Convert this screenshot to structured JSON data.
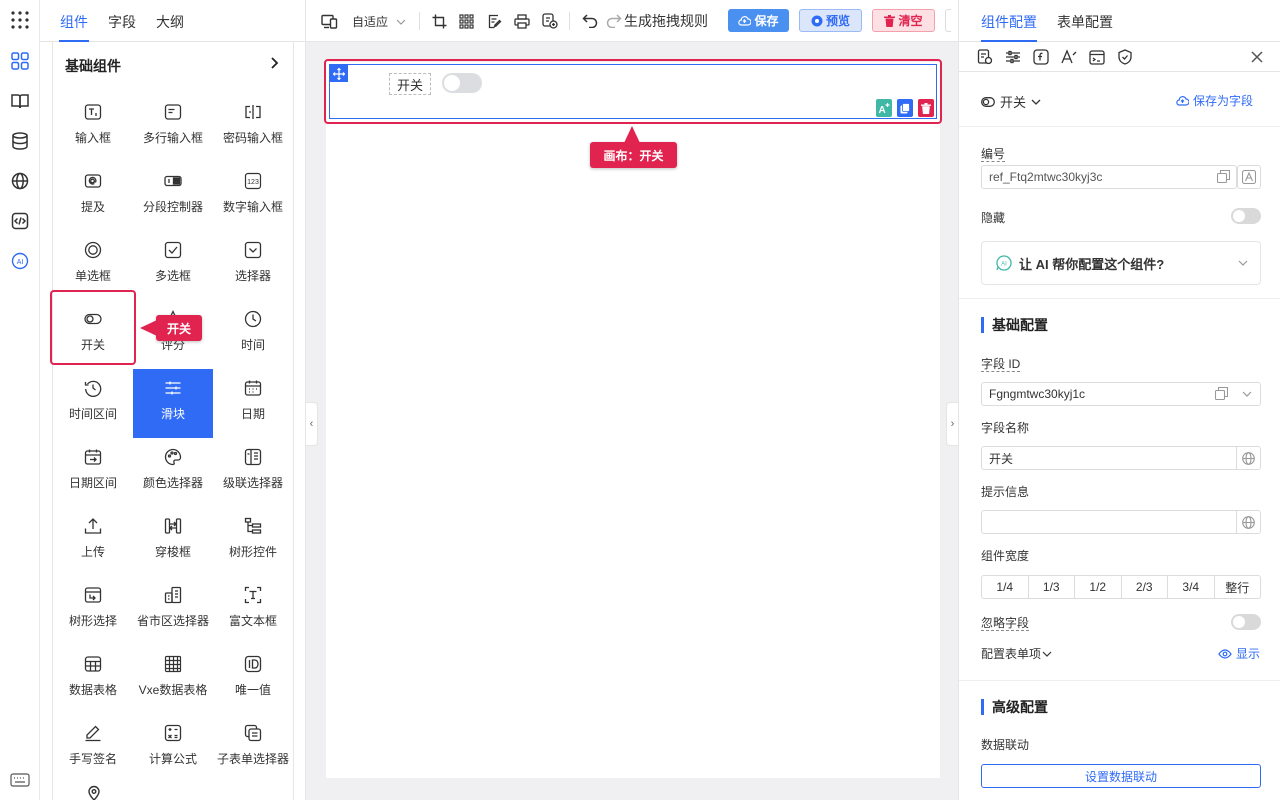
{
  "left_tabs": [
    "组件",
    "字段",
    "大纲"
  ],
  "group_title": "基础组件",
  "components": [
    {
      "label": "输入框",
      "icon": "text-input-icon"
    },
    {
      "label": "多行输入框",
      "icon": "textarea-icon"
    },
    {
      "label": "密码输入框",
      "icon": "password-icon"
    },
    {
      "label": "提及",
      "icon": "mention-icon"
    },
    {
      "label": "分段控制器",
      "icon": "segmented-icon"
    },
    {
      "label": "数字输入框",
      "icon": "number-input-icon"
    },
    {
      "label": "单选框",
      "icon": "radio-icon"
    },
    {
      "label": "多选框",
      "icon": "checkbox-icon"
    },
    {
      "label": "选择器",
      "icon": "select-icon"
    },
    {
      "label": "开关",
      "icon": "switch-icon"
    },
    {
      "label": "评分",
      "icon": "rate-icon"
    },
    {
      "label": "时间",
      "icon": "time-icon"
    },
    {
      "label": "时间区间",
      "icon": "time-range-icon"
    },
    {
      "label": "滑块",
      "icon": "slider-icon"
    },
    {
      "label": "日期",
      "icon": "date-icon"
    },
    {
      "label": "日期区间",
      "icon": "date-range-icon"
    },
    {
      "label": "颜色选择器",
      "icon": "color-picker-icon"
    },
    {
      "label": "级联选择器",
      "icon": "cascader-icon"
    },
    {
      "label": "上传",
      "icon": "upload-icon"
    },
    {
      "label": "穿梭框",
      "icon": "transfer-icon"
    },
    {
      "label": "树形控件",
      "icon": "tree-icon"
    },
    {
      "label": "树形选择",
      "icon": "tree-select-icon"
    },
    {
      "label": "省市区选择器",
      "icon": "region-icon"
    },
    {
      "label": "富文本框",
      "icon": "richtext-icon"
    },
    {
      "label": "数据表格",
      "icon": "table-icon"
    },
    {
      "label": "Vxe数据表格",
      "icon": "vxe-table-icon"
    },
    {
      "label": "唯一值",
      "icon": "id-icon"
    },
    {
      "label": "手写签名",
      "icon": "signature-icon"
    },
    {
      "label": "计算公式",
      "icon": "calculator-icon"
    },
    {
      "label": "子表单选择器",
      "icon": "subform-icon"
    }
  ],
  "left_tag": "开关",
  "toolbar": {
    "adaptive": "自适应",
    "rules": "生成拖拽规则",
    "save": "保存",
    "preview": "预览",
    "clear": "清空"
  },
  "canvas": {
    "field_label": "开关",
    "switch_on": false,
    "tag": "画布：开关"
  },
  "right_tabs": [
    "组件配置",
    "表单配置"
  ],
  "config": {
    "component_type": "开关",
    "save_as_field": "保存为字段",
    "id_label": "编号",
    "id_value": "ref_Ftq2mtwc30kyj3c",
    "hidden_label": "隐藏",
    "ai_prompt": "让 AI 帮你配置这个组件?",
    "basic_title": "基础配置",
    "field_id_label": "字段 ID",
    "field_id_value": "Fgngmtwc30kyj1c",
    "field_name_label": "字段名称",
    "field_name_value": "开关",
    "hint_label": "提示信息",
    "hint_value": "",
    "width_label": "组件宽度",
    "width_options": [
      "1/4",
      "1/3",
      "1/2",
      "2/3",
      "3/4",
      "整行"
    ],
    "ignore_label": "忽略字段",
    "form_items_label": "配置表单项",
    "show_label": "显示",
    "advanced_title": "高级配置",
    "linkage_label": "数据联动",
    "linkage_button": "设置数据联动"
  },
  "colors": {
    "primary": "#2f6bf5",
    "highlight": "#e0234f",
    "save_bg": "#4a90f0",
    "preview_bg": "#dbe6fb",
    "clear_bg": "#fde0e3"
  }
}
